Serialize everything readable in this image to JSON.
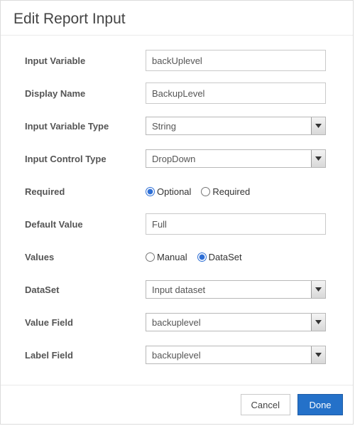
{
  "header": {
    "title": "Edit Report Input"
  },
  "labels": {
    "input_variable": "Input Variable",
    "display_name": "Display Name",
    "input_variable_type": "Input Variable Type",
    "input_control_type": "Input Control Type",
    "required": "Required",
    "default_value": "Default Value",
    "values": "Values",
    "dataset": "DataSet",
    "value_field": "Value Field",
    "label_field": "Label Field"
  },
  "fields": {
    "input_variable": "backUplevel",
    "display_name": "BackupLevel",
    "input_variable_type": "String",
    "input_control_type": "DropDown",
    "default_value": "Full",
    "dataset": "Input dataset",
    "value_field": "backuplevel",
    "label_field": "backuplevel"
  },
  "radios": {
    "required": {
      "optional_label": "Optional",
      "required_label": "Required",
      "selected": "optional"
    },
    "values": {
      "manual_label": "Manual",
      "dataset_label": "DataSet",
      "selected": "dataset"
    }
  },
  "buttons": {
    "cancel": "Cancel",
    "done": "Done"
  }
}
